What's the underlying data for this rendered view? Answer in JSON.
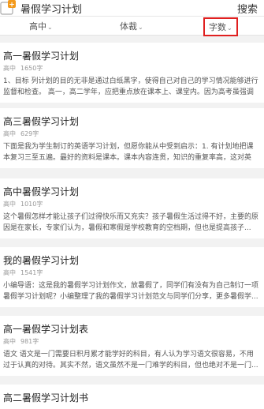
{
  "header": {
    "search_text": "暑假学习计划",
    "search_button": "搜索"
  },
  "filters": [
    {
      "label": "高中",
      "arrow": "⌄"
    },
    {
      "label": "体裁",
      "arrow": "⌄"
    },
    {
      "label": "字数",
      "arrow": "⌄"
    }
  ],
  "results": [
    {
      "title": "高一暑假学习计划",
      "grade": "高中",
      "words": "1650字",
      "snippet": [
        "1、目标 列计划的目的无非是通过白纸黑字，使得自己对自己的学习情况能够进行",
        "监督和检查。 高一，高二学年，应把重点放在课本上、课堂内。因为高考虽强调"
      ]
    },
    {
      "title": "高三暑假学习计划",
      "grade": "高中",
      "words": "629字",
      "snippet": [
        "下面是我为学生制订的英语学习计划，但愿你能从中受到启示：1. 有计划地把课",
        "本复习三至五遍。最好的资料是课本。课本内容连贯，知识的重复率高，这对英"
      ]
    },
    {
      "title": "高中暑假学习计划",
      "grade": "高中",
      "words": "1010字",
      "snippet": [
        "这个暑假怎样才能让孩子们过得快乐而又充实？孩子暑假生活过得不好，主要的原",
        "因是在家长，专家们认为，暑假和寒假是学校教育的空档期，但也是提高孩子..."
      ]
    },
    {
      "title": "我的暑假学习计划",
      "grade": "高中",
      "words": "1541字",
      "snippet": [
        "小编导语：这是我的暑假学习计划作文，放暑假了，同学们有没有为自己制订一项",
        "暑假学习计划呢？小编整理了我的暑假学习计划范文与同学们分享，更多暑假学..."
      ]
    },
    {
      "title": "高一暑假学习计划表",
      "grade": "高中",
      "words": "981字",
      "snippet": [
        "语文 语文是一门需要日积月累才能学好的科目，有人认为学习语文很容易，不用",
        "过于认真的对待。其实不然，语文虽然不是一门难学的科目，但也绝对不是一门..."
      ]
    },
    {
      "title": "高二暑假学习计划书",
      "grade": "高中",
      "words": "",
      "snippet": []
    }
  ]
}
